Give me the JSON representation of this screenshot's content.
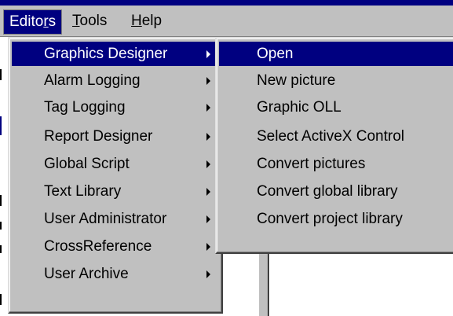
{
  "menubar": {
    "items": [
      {
        "label_pre": "Edito",
        "underline": "r",
        "label_post": "s"
      },
      {
        "label_pre": "",
        "underline": "T",
        "label_post": "ools"
      },
      {
        "label_pre": "",
        "underline": "H",
        "label_post": "elp"
      }
    ]
  },
  "editors_menu": {
    "items": [
      {
        "label": "Graphics Designer",
        "highlighted": true,
        "submenu": true
      },
      {
        "label": "Alarm Logging",
        "submenu": true
      },
      {
        "label": "Tag Logging",
        "submenu": true
      },
      {
        "label": "Report Designer",
        "submenu": true
      },
      {
        "label": "Global Script",
        "submenu": true
      },
      {
        "label": "Text Library",
        "submenu": true
      },
      {
        "label": "User Administrator",
        "submenu": true
      },
      {
        "label": "CrossReference",
        "submenu": true
      },
      {
        "label": "User Archive",
        "submenu": true
      }
    ]
  },
  "graphics_submenu": {
    "items": [
      {
        "label": "Open",
        "highlighted": true
      },
      {
        "label": "New picture"
      },
      {
        "label": "Graphic OLL"
      },
      {
        "label": "Select ActiveX Control"
      },
      {
        "label": "Convert pictures"
      },
      {
        "label": "Convert global library"
      },
      {
        "label": "Convert project library"
      }
    ]
  },
  "colors": {
    "highlight": "#000080",
    "menu_face": "#c0c0c0",
    "highlight_text": "#ffffff"
  }
}
